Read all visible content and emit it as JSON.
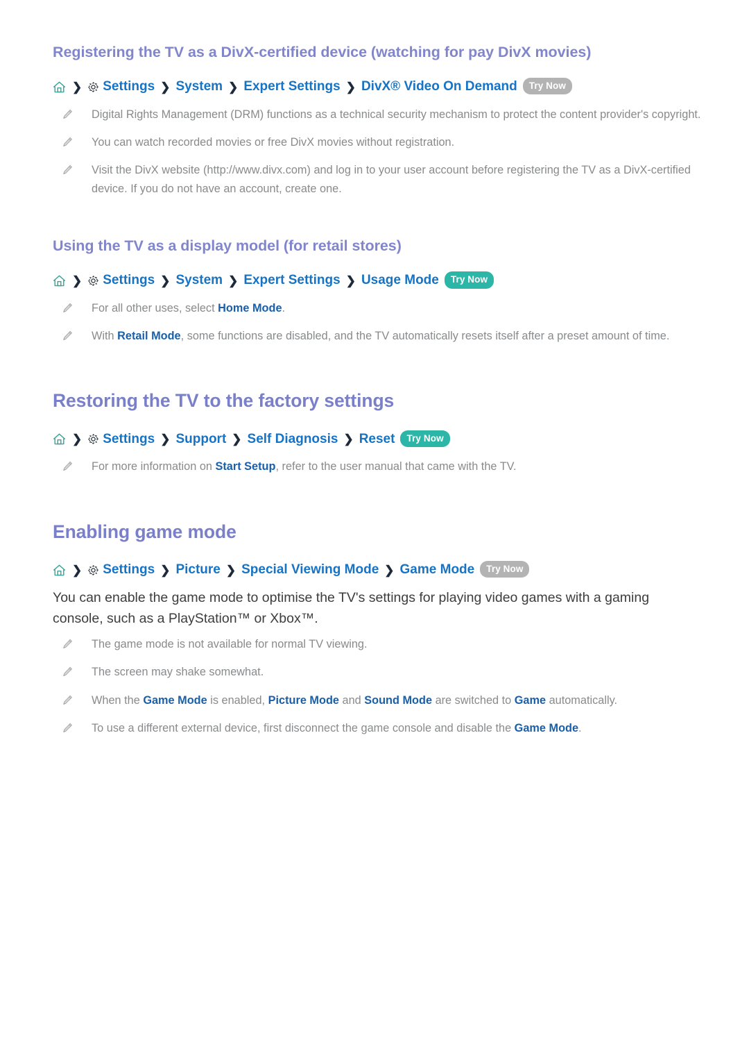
{
  "document": {
    "title": "TV Settings e-Manual page",
    "colors": {
      "heading": "#7a7fc9",
      "breadcrumb_link": "#1773c4",
      "inline_link": "#1a5fa8",
      "note_text": "#888a8c",
      "body_text": "#3d3d3f",
      "badge_teal": "#2bb6a8",
      "badge_gray": "#b3b3b3",
      "home_icon": "#2f9e96",
      "chevron": "#1c2a3a"
    }
  },
  "sections": [
    {
      "id": "divx-registration",
      "heading": "Registering the TV as a DivX-certified device (watching for pay DivX movies)",
      "heading_level": "sub",
      "breadcrumb": {
        "home_icon": "home-icon",
        "gear_icon": "gear-icon",
        "chevron_icon": "chevron-right-icon",
        "items": [
          "Settings",
          "System",
          "Expert Settings",
          "DivX® Video On Demand"
        ],
        "badge": {
          "label": "Try Now",
          "style": "gray"
        }
      },
      "notes": [
        {
          "icon": "pencil-icon",
          "parts": [
            {
              "text": "Digital Rights Management (DRM) functions as a technical security mechanism to protect the content provider's copyright.",
              "link": false
            }
          ]
        },
        {
          "icon": "pencil-icon",
          "parts": [
            {
              "text": "You can watch recorded movies or free DivX movies without registration.",
              "link": false
            }
          ]
        },
        {
          "icon": "pencil-icon",
          "parts": [
            {
              "text": "Visit the DivX website (http://www.divx.com) and log in to your user account before registering the TV as a DivX-certified device. If you do not have an account, create one.",
              "link": false
            }
          ]
        }
      ]
    },
    {
      "id": "retail-display-model",
      "heading": "Using the TV as a display model (for retail stores)",
      "heading_level": "sub",
      "breadcrumb": {
        "home_icon": "home-icon",
        "gear_icon": "gear-icon",
        "chevron_icon": "chevron-right-icon",
        "items": [
          "Settings",
          "System",
          "Expert Settings",
          "Usage Mode"
        ],
        "badge": {
          "label": "Try Now",
          "style": "teal"
        }
      },
      "notes": [
        {
          "icon": "pencil-icon",
          "parts": [
            {
              "text": "For all other uses, select ",
              "link": false
            },
            {
              "text": "Home Mode",
              "link": true
            },
            {
              "text": ".",
              "link": false
            }
          ]
        },
        {
          "icon": "pencil-icon",
          "parts": [
            {
              "text": "With ",
              "link": false
            },
            {
              "text": "Retail Mode",
              "link": true
            },
            {
              "text": ", some functions are disabled, and the TV automatically resets itself after a preset amount of time.",
              "link": false
            }
          ]
        }
      ]
    },
    {
      "id": "factory-reset",
      "heading": "Restoring the TV to the factory settings",
      "heading_level": "main",
      "breadcrumb": {
        "home_icon": "home-icon",
        "gear_icon": "gear-icon",
        "chevron_icon": "chevron-right-icon",
        "items": [
          "Settings",
          "Support",
          "Self Diagnosis",
          "Reset"
        ],
        "badge": {
          "label": "Try Now",
          "style": "teal"
        }
      },
      "notes": [
        {
          "icon": "pencil-icon",
          "parts": [
            {
              "text": "For more information on ",
              "link": false
            },
            {
              "text": "Start Setup",
              "link": true
            },
            {
              "text": ", refer to the user manual that came with the TV.",
              "link": false
            }
          ]
        }
      ]
    },
    {
      "id": "game-mode",
      "heading": "Enabling game mode",
      "heading_level": "main",
      "breadcrumb": {
        "home_icon": "home-icon",
        "gear_icon": "gear-icon",
        "chevron_icon": "chevron-right-icon",
        "items": [
          "Settings",
          "Picture",
          "Special Viewing Mode",
          "Game Mode"
        ],
        "badge": {
          "label": "Try Now",
          "style": "gray"
        }
      },
      "paragraph": "You can enable the game mode to optimise the TV's settings for playing video games with a gaming console, such as a PlayStation™ or Xbox™.",
      "notes": [
        {
          "icon": "pencil-icon",
          "parts": [
            {
              "text": "The game mode is not available for normal TV viewing.",
              "link": false
            }
          ]
        },
        {
          "icon": "pencil-icon",
          "parts": [
            {
              "text": "The screen may shake somewhat.",
              "link": false
            }
          ]
        },
        {
          "icon": "pencil-icon",
          "parts": [
            {
              "text": "When the ",
              "link": false
            },
            {
              "text": "Game Mode",
              "link": true
            },
            {
              "text": " is enabled, ",
              "link": false
            },
            {
              "text": "Picture Mode",
              "link": true
            },
            {
              "text": " and ",
              "link": false
            },
            {
              "text": "Sound Mode",
              "link": true
            },
            {
              "text": " are switched to ",
              "link": false
            },
            {
              "text": "Game",
              "link": true
            },
            {
              "text": " automatically.",
              "link": false
            }
          ]
        },
        {
          "icon": "pencil-icon",
          "parts": [
            {
              "text": "To use a different external device, first disconnect the game console and disable the ",
              "link": false
            },
            {
              "text": "Game Mode",
              "link": true
            },
            {
              "text": ".",
              "link": false
            }
          ]
        }
      ]
    }
  ]
}
